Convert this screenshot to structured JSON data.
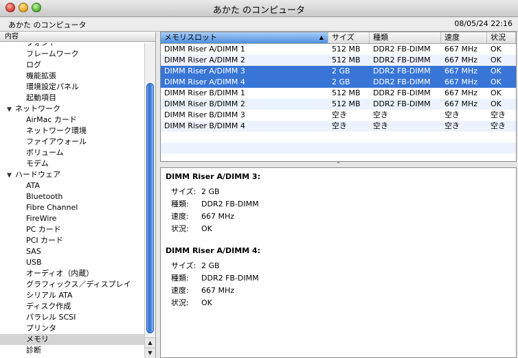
{
  "window": {
    "title": "あかた のコンピュータ"
  },
  "infobar": {
    "computer_name": "あかた のコンピュータ",
    "datetime": "08/05/24 22:16"
  },
  "sidebar": {
    "header": "内容",
    "rows": [
      {
        "label": "フォント",
        "type": "item"
      },
      {
        "label": "フレームワーク",
        "type": "item"
      },
      {
        "label": "ログ",
        "type": "item"
      },
      {
        "label": "機能拡張",
        "type": "item"
      },
      {
        "label": "環境設定パネル",
        "type": "item"
      },
      {
        "label": "起動項目",
        "type": "item"
      },
      {
        "label": "ネットワーク",
        "type": "category"
      },
      {
        "label": "AirMac カード",
        "type": "item"
      },
      {
        "label": "ネットワーク環境",
        "type": "item"
      },
      {
        "label": "ファイアウォール",
        "type": "item"
      },
      {
        "label": "ボリューム",
        "type": "item"
      },
      {
        "label": "モデム",
        "type": "item"
      },
      {
        "label": "ハードウェア",
        "type": "category"
      },
      {
        "label": "ATA",
        "type": "item"
      },
      {
        "label": "Bluetooth",
        "type": "item"
      },
      {
        "label": "Fibre Channel",
        "type": "item"
      },
      {
        "label": "FireWire",
        "type": "item"
      },
      {
        "label": "PC カード",
        "type": "item"
      },
      {
        "label": "PCI カード",
        "type": "item"
      },
      {
        "label": "SAS",
        "type": "item"
      },
      {
        "label": "USB",
        "type": "item"
      },
      {
        "label": "オーディオ（内蔵）",
        "type": "item"
      },
      {
        "label": "グラフィックス／ディスプレイ",
        "type": "item"
      },
      {
        "label": "シリアル ATA",
        "type": "item"
      },
      {
        "label": "ディスク作成",
        "type": "item"
      },
      {
        "label": "パラレル SCSI",
        "type": "item"
      },
      {
        "label": "プリンタ",
        "type": "item"
      },
      {
        "label": "メモリ",
        "type": "item",
        "selected": true
      },
      {
        "label": "診断",
        "type": "item"
      }
    ]
  },
  "table": {
    "columns": [
      "メモリスロット",
      "サイズ",
      "種類",
      "速度",
      "状況"
    ],
    "rows": [
      {
        "cells": [
          "DIMM Riser A/DIMM 1",
          "512 MB",
          "DDR2 FB-DIMM",
          "667 MHz",
          "OK"
        ]
      },
      {
        "cells": [
          "DIMM Riser A/DIMM 2",
          "512 MB",
          "DDR2 FB-DIMM",
          "667 MHz",
          "OK"
        ]
      },
      {
        "cells": [
          "DIMM Riser A/DIMM 3",
          "2 GB",
          "DDR2 FB-DIMM",
          "667 MHz",
          "OK"
        ],
        "selected": true
      },
      {
        "cells": [
          "DIMM Riser A/DIMM 4",
          "2 GB",
          "DDR2 FB-DIMM",
          "667 MHz",
          "OK"
        ],
        "selected": true
      },
      {
        "cells": [
          "DIMM Riser B/DIMM 1",
          "512 MB",
          "DDR2 FB-DIMM",
          "667 MHz",
          "OK"
        ]
      },
      {
        "cells": [
          "DIMM Riser B/DIMM 2",
          "512 MB",
          "DDR2 FB-DIMM",
          "667 MHz",
          "OK"
        ]
      },
      {
        "cells": [
          "DIMM Riser B/DIMM 3",
          "空き",
          "空き",
          "空き",
          "空き"
        ]
      },
      {
        "cells": [
          "DIMM Riser B/DIMM 4",
          "空き",
          "空き",
          "空き",
          "空き"
        ]
      }
    ]
  },
  "detail": {
    "sections": [
      {
        "heading": "DIMM Riser A/DIMM 3:",
        "fields": [
          {
            "key": "サイズ:",
            "value": "2 GB"
          },
          {
            "key": "種類:",
            "value": "DDR2 FB-DIMM"
          },
          {
            "key": "速度:",
            "value": "667 MHz"
          },
          {
            "key": "状況:",
            "value": "OK"
          }
        ]
      },
      {
        "heading": "DIMM Riser A/DIMM 4:",
        "fields": [
          {
            "key": "サイズ:",
            "value": "2 GB"
          },
          {
            "key": "種類:",
            "value": "DDR2 FB-DIMM"
          },
          {
            "key": "速度:",
            "value": "667 MHz"
          },
          {
            "key": "状況:",
            "value": "OK"
          }
        ]
      }
    ]
  },
  "colors": {
    "selection": "#3875d7",
    "alt_row": "#edf3fe",
    "scroll_thumb": "#2f6fd0"
  },
  "icons": {
    "expand": "disclosure-triangle-icon",
    "scroll_up": "scroll-up-arrow-icon",
    "scroll_down": "scroll-down-arrow-icon",
    "sort": "sort-ascending-icon"
  }
}
